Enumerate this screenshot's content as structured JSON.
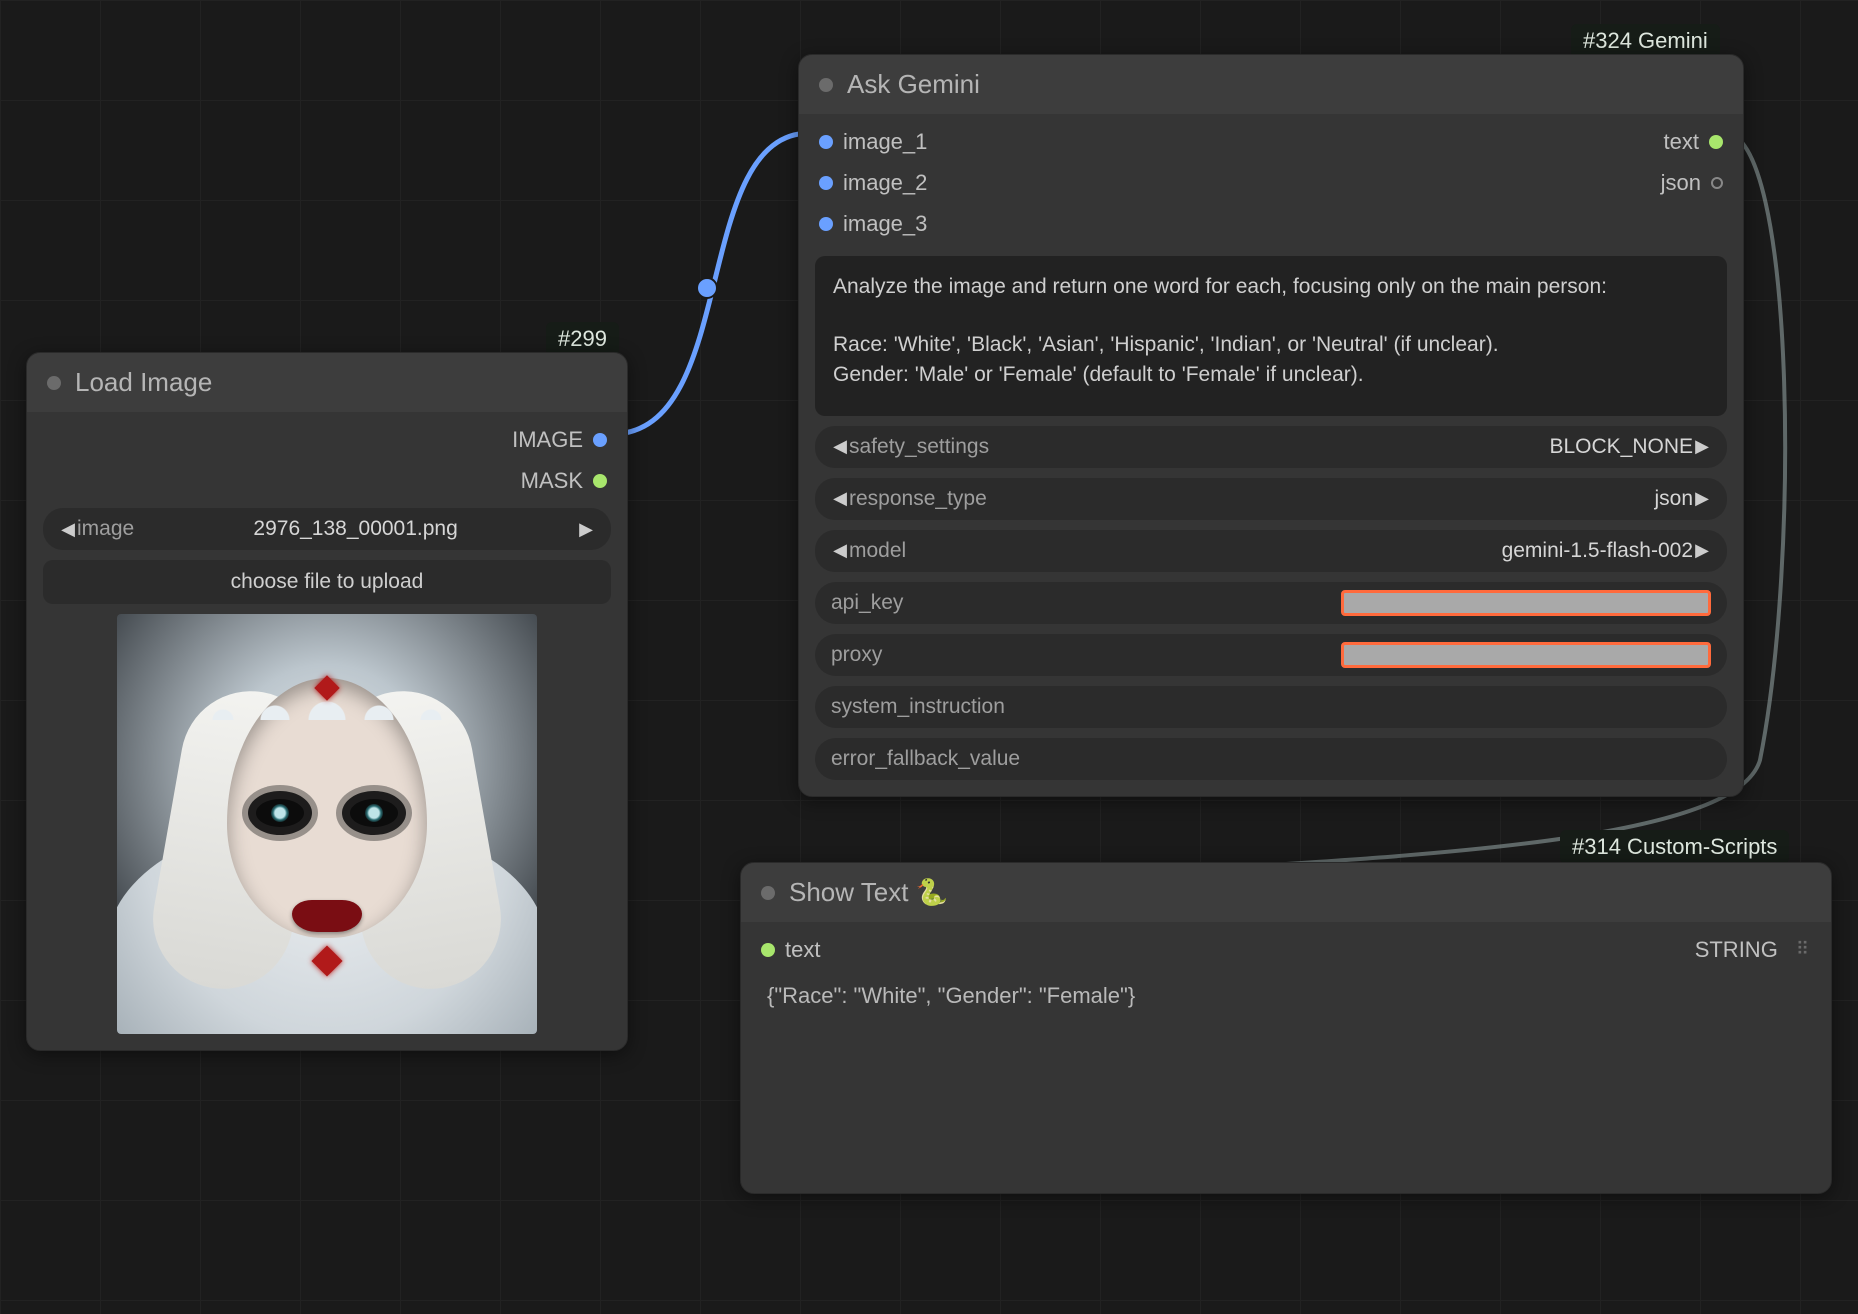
{
  "badges": {
    "load_image": "#299",
    "gemini": "#324 Gemini",
    "custom_scripts": "#314 Custom-Scripts"
  },
  "load_image_node": {
    "title": "Load Image",
    "outputs": {
      "image": "IMAGE",
      "mask": "MASK"
    },
    "image_widget": {
      "label": "image",
      "value": "2976_138_00001.png"
    },
    "choose_file_label": "choose file to upload"
  },
  "gemini_node": {
    "title": "Ask Gemini",
    "inputs": {
      "image_1": "image_1",
      "image_2": "image_2",
      "image_3": "image_3"
    },
    "outputs": {
      "text": "text",
      "json": "json"
    },
    "prompt": "Analyze the image and return one word for each, focusing only on the main person:\n\nRace: 'White', 'Black', 'Asian', 'Hispanic', 'Indian', or 'Neutral' (if unclear).\nGender: 'Male' or 'Female' (default to 'Female' if unclear).",
    "safety_settings": {
      "label": "safety_settings",
      "value": "BLOCK_NONE"
    },
    "response_type": {
      "label": "response_type",
      "value": "json"
    },
    "model": {
      "label": "model",
      "value": "gemini-1.5-flash-002"
    },
    "api_key_label": "api_key",
    "proxy_label": "proxy",
    "system_instruction_label": "system_instruction",
    "error_fallback_label": "error_fallback_value"
  },
  "show_text_node": {
    "title": "Show Text 🐍",
    "input_label": "text",
    "output_label": "STRING",
    "output_text": "{\"Race\": \"White\", \"Gender\": \"Female\"}"
  }
}
